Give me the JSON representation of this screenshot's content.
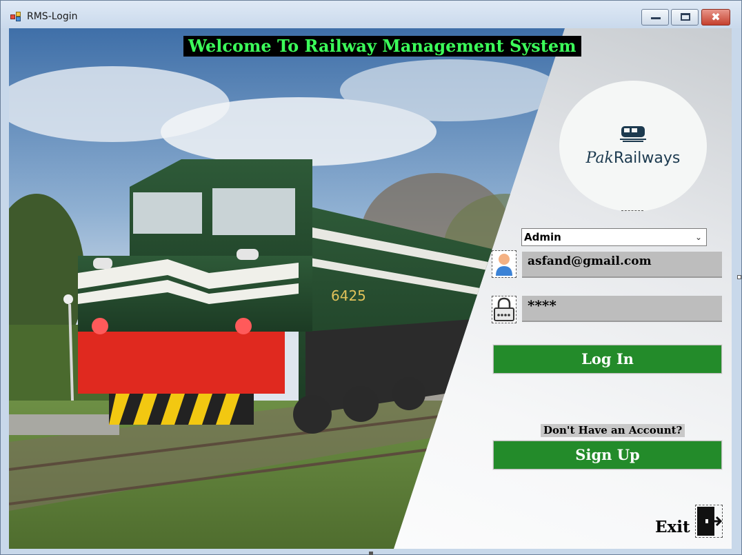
{
  "window": {
    "title": "RMS-Login",
    "close_glyph": "✖"
  },
  "header": {
    "welcome_text": "Welcome To Railway Management System"
  },
  "logo": {
    "brand_prefix": "Pak",
    "brand_suffix": "Railways",
    "icon": "train-icon"
  },
  "form": {
    "role_selected": "Admin",
    "email_value": "asfand@gmail.com",
    "password_value": "****",
    "login_label": "Log In",
    "no_account_text": "Don't Have an Account?",
    "signup_label": "Sign Up",
    "exit_label": "Exit"
  },
  "colors": {
    "button_green": "#238b2a",
    "welcome_text": "#3cff5a",
    "welcome_bg": "#000000",
    "field_bg": "#bdbdbd"
  }
}
